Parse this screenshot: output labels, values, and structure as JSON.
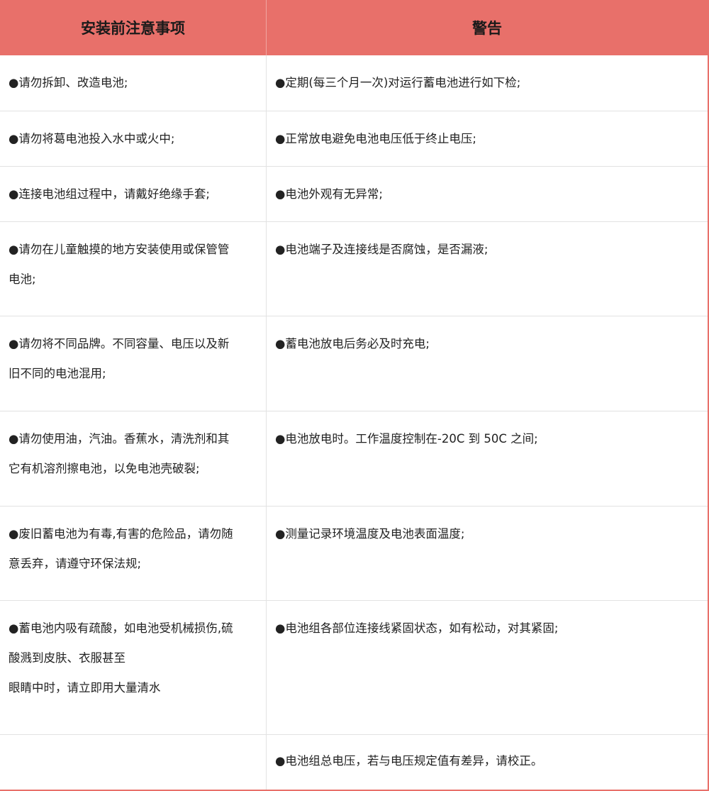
{
  "header": {
    "left": "安装前注意事项",
    "right": "警告"
  },
  "rows": [
    {
      "left": [
        "●请勿拆卸、改造电池;"
      ],
      "right": [
        "●定期(每三个月一次)对运行蓄电池进行如下检;"
      ]
    },
    {
      "left": [
        "●请勿将葛电池投入水中或火中;"
      ],
      "right": [
        "●正常放电避免电池电压低于终止电压;"
      ]
    },
    {
      "left": [
        "●连接电池组过程中，请戴好绝缘手套;"
      ],
      "right": [
        "●电池外观有无异常;"
      ]
    },
    {
      "left": [
        "●请勿在儿童触摸的地方安装使用或保管管",
        "电池;"
      ],
      "right": [
        "●电池端子及连接线是否腐蚀，是否漏液;"
      ]
    },
    {
      "left": [
        "●请勿将不同品牌。不同容量、电压以及新",
        "旧不同的电池混用;"
      ],
      "right": [
        "●蓄电池放电后务必及时充电;"
      ]
    },
    {
      "left": [
        "●请勿使用油，汽油。香蕉水，清洗剂和其",
        "它有机溶剂擦电池，以免电池壳破裂;"
      ],
      "right": [
        "●电池放电时。工作温度控制在-20C 到 50C 之间;"
      ]
    },
    {
      "left": [
        "●废旧蓄电池为有毒,有害的危险品，请勿随",
        "意丢弃，请遵守环保法规;"
      ],
      "right": [
        "●测量记录环境温度及电池表面温度;"
      ]
    },
    {
      "left": [
        "●蓄电池内吸有疏酸，如电池受机械损伤,硫",
        "酸溅到皮肤、衣服甚至",
        "眼睛中时，请立即用大量清水"
      ],
      "right": [
        "●电池组各部位连接线紧固状态，如有松动，对其紧固;"
      ]
    },
    {
      "left": [],
      "right": [
        "●电池组总电压，若与电压规定值有差异，请校正。"
      ]
    }
  ],
  "colors": {
    "header_bg": "#e8706a",
    "grid": "#e2e2e2",
    "text": "#222222"
  }
}
